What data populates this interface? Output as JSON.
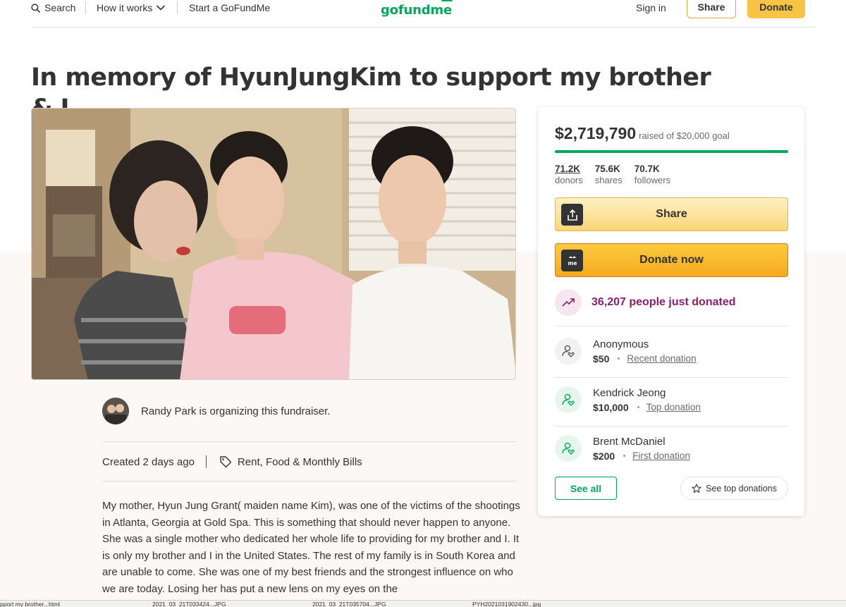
{
  "header": {
    "search_label": "Search",
    "how_it_works_label": "How it works",
    "start_label": "Start a GoFundMe",
    "logo_text": "gofundme",
    "signin_label": "Sign in",
    "share_label": "Share",
    "donate_label": "Donate"
  },
  "page_title": "In memory of HyunJungKim to support my brother & I",
  "organizer": {
    "text": "Randy Park is organizing this fundraiser."
  },
  "meta": {
    "created": "Created 2 days ago",
    "category": "Rent, Food & Monthly Bills"
  },
  "story": "My mother, Hyun Jung Grant( maiden name Kim), was one of the victims of the shootings in Atlanta, Georgia at Gold Spa. This is something that should never happen to anyone. She was a single mother who dedicated her whole life to providing for my brother and I. It is only my brother and I in the United States. The rest of my family is in South Korea and are unable to come. She was one of my best friends and the strongest influence on who we are today. Losing her has put a new lens on my eyes on the",
  "sidebar": {
    "raised": "$2,719,790",
    "goal_text": "raised of $20,000 goal",
    "progress_fraction": 1.0,
    "stats": [
      {
        "value": "71.2K",
        "label": "donors"
      },
      {
        "value": "75.6K",
        "label": "shares"
      },
      {
        "value": "70.7K",
        "label": "followers"
      }
    ],
    "share_button": "Share",
    "donate_button": "Donate now",
    "donate_icon_text": "me",
    "trend_text": "36,207 people just donated",
    "donations": [
      {
        "name": "Anonymous",
        "amount": "$50",
        "kind": "Recent donation"
      },
      {
        "name": "Kendrick Jeong",
        "amount": "$10,000",
        "kind": "Top donation"
      },
      {
        "name": "Brent McDaniel",
        "amount": "$200",
        "kind": "First donation"
      }
    ],
    "see_all": "See all",
    "see_top": "See top donations"
  },
  "download_shelf": [
    "pport my brother...html",
    "2021_03_21T033424...JPG",
    "2021_03_21T035704...JPG",
    "PYH2021031902430...jpg"
  ],
  "colors": {
    "brand_green": "#02a95c",
    "donate_yellow": "#f8c446",
    "trend_purple": "#8a1f6f"
  },
  "icons": [
    "search-icon",
    "chevron-down-icon",
    "upload-icon",
    "gofundme-me-icon",
    "trending-up-icon",
    "donor-heart-icon",
    "tag-icon",
    "star-icon"
  ]
}
